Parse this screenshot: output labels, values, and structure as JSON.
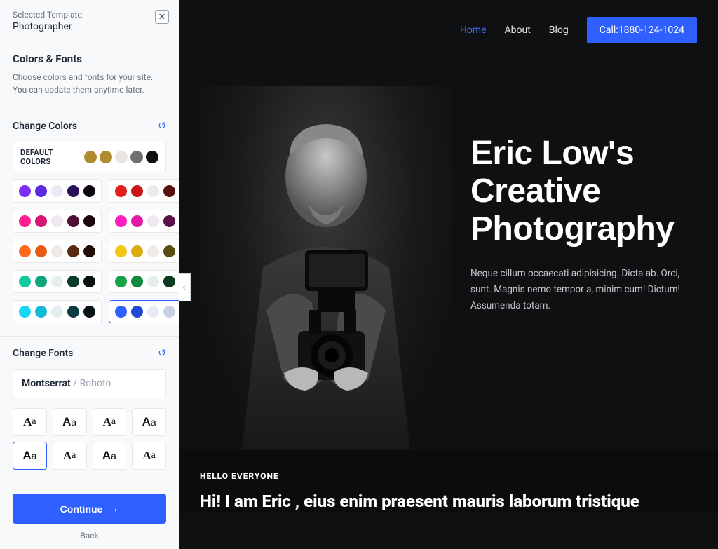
{
  "sidebar": {
    "selected_label": "Selected Template:",
    "template_name": "Photographer",
    "intro_title": "Colors & Fonts",
    "intro_desc": "Choose colors and fonts for your site. You can update them anytime later.",
    "colors_title": "Change Colors",
    "default_label": "DEFAULT COLORS",
    "default_swatches": [
      "#b08a2e",
      "#b08a2e",
      "#e9e6e2",
      "#6f6f6f",
      "#0f0f0f"
    ],
    "palettes": [
      {
        "c": [
          "#7b2ff2",
          "#5a2be0",
          "#ece8f5",
          "#2a1057",
          "#0e0712"
        ]
      },
      {
        "c": [
          "#e11d1d",
          "#c91515",
          "#efeaea",
          "#5a1010",
          "#2a0707"
        ]
      },
      {
        "c": [
          "#ff1f8f",
          "#d81677",
          "#efe7ee",
          "#4d0f34",
          "#1e0611"
        ]
      },
      {
        "c": [
          "#ff1fbf",
          "#e01aa7",
          "#efe7ef",
          "#5a1048",
          "#22081b"
        ]
      },
      {
        "c": [
          "#ff6b1a",
          "#e65a12",
          "#efe9e3",
          "#5a2a10",
          "#1f0e05"
        ]
      },
      {
        "c": [
          "#f5c518",
          "#d9ab10",
          "#efede3",
          "#5a4d10",
          "#1f1a05"
        ]
      },
      {
        "c": [
          "#12c99b",
          "#0ea47c",
          "#e5efec",
          "#0a3a2d",
          "#08130f"
        ]
      },
      {
        "c": [
          "#14a34a",
          "#0e8a3d",
          "#e4efe8",
          "#0b3a1f",
          "#08130b"
        ]
      },
      {
        "c": [
          "#18d6f2",
          "#12bcd6",
          "#e4eef0",
          "#0a3a42",
          "#061214"
        ]
      },
      {
        "c": [
          "#2f5fff",
          "#2249d6",
          "#e6ebf5",
          "#c8d0e2",
          "#0a1533"
        ],
        "selected": true
      }
    ],
    "fonts_title": "Change Fonts",
    "font_primary": "Montserrat",
    "font_secondary": "Roboto",
    "font_samples": [
      {
        "fam": "serif"
      },
      {
        "fam": "sans"
      },
      {
        "fam": "serif"
      },
      {
        "fam": "sans"
      },
      {
        "fam": "sans",
        "selected": true
      },
      {
        "fam": "serif"
      },
      {
        "fam": "sans"
      },
      {
        "fam": "serif"
      }
    ],
    "continue_label": "Continue",
    "back_label": "Back"
  },
  "preview": {
    "nav": [
      {
        "label": "Home",
        "active": true
      },
      {
        "label": "About"
      },
      {
        "label": "Blog"
      }
    ],
    "call_btn": "Call:1880-124-1024",
    "hero_title": "Eric Low's Creative Photography",
    "hero_desc": "Neque cillum occaecati adipisicing. Dicta ab. Orci, sunt. Magnis nemo tempor a, minim cum! Dictum! Assumenda totam.",
    "kicker": "HELLO EVERYONE",
    "subhead": "Hi! I am Eric , eius enim praesent mauris laborum tristique"
  }
}
